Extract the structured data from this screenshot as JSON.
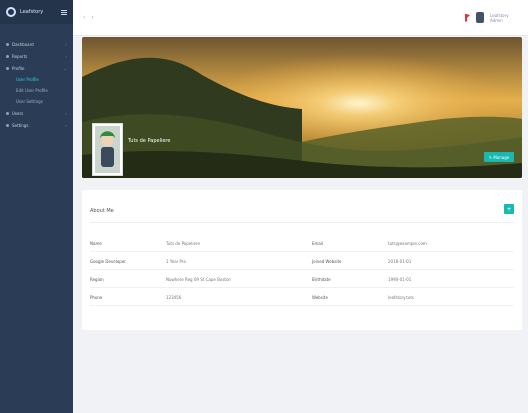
{
  "sidebar": {
    "brand_name": "Leafstory",
    "section_label": "",
    "items": [
      {
        "label": "Dashboard",
        "chev": "›"
      },
      {
        "label": "Reports",
        "chev": "›"
      },
      {
        "label": "Profile",
        "chev": "⌄"
      },
      {
        "label": "Users",
        "chev": "›"
      },
      {
        "label": "Settings",
        "chev": "›"
      }
    ],
    "subitems": [
      {
        "label": "User Profile"
      },
      {
        "label": "Edit User Profile"
      },
      {
        "label": "User Settings"
      }
    ]
  },
  "topbar": {
    "back": "‹",
    "forward": "›",
    "username": "Leafstory Admin"
  },
  "profile": {
    "name": "Tuts de Papeliere",
    "edit_label": "✎ Manage"
  },
  "about": {
    "title": "About Me",
    "add_icon": "+",
    "rows": [
      {
        "k1": "Name",
        "v1": "Tuts de Papeliere",
        "k2": "Email",
        "v2": "tuts@example.com"
      },
      {
        "k1": "Google Developer",
        "v1": "1 Year Pro",
        "k2": "Joined Website",
        "v2": "2018-01-01"
      },
      {
        "k1": "Region",
        "v1": "Nowhere Reg 09 St Cape Boston",
        "k2": "Birthdate",
        "v2": "1990-01-01"
      },
      {
        "k1": "Phone",
        "v1": "123456",
        "k2": "Website",
        "v2": "leafstory.tuts"
      }
    ]
  }
}
